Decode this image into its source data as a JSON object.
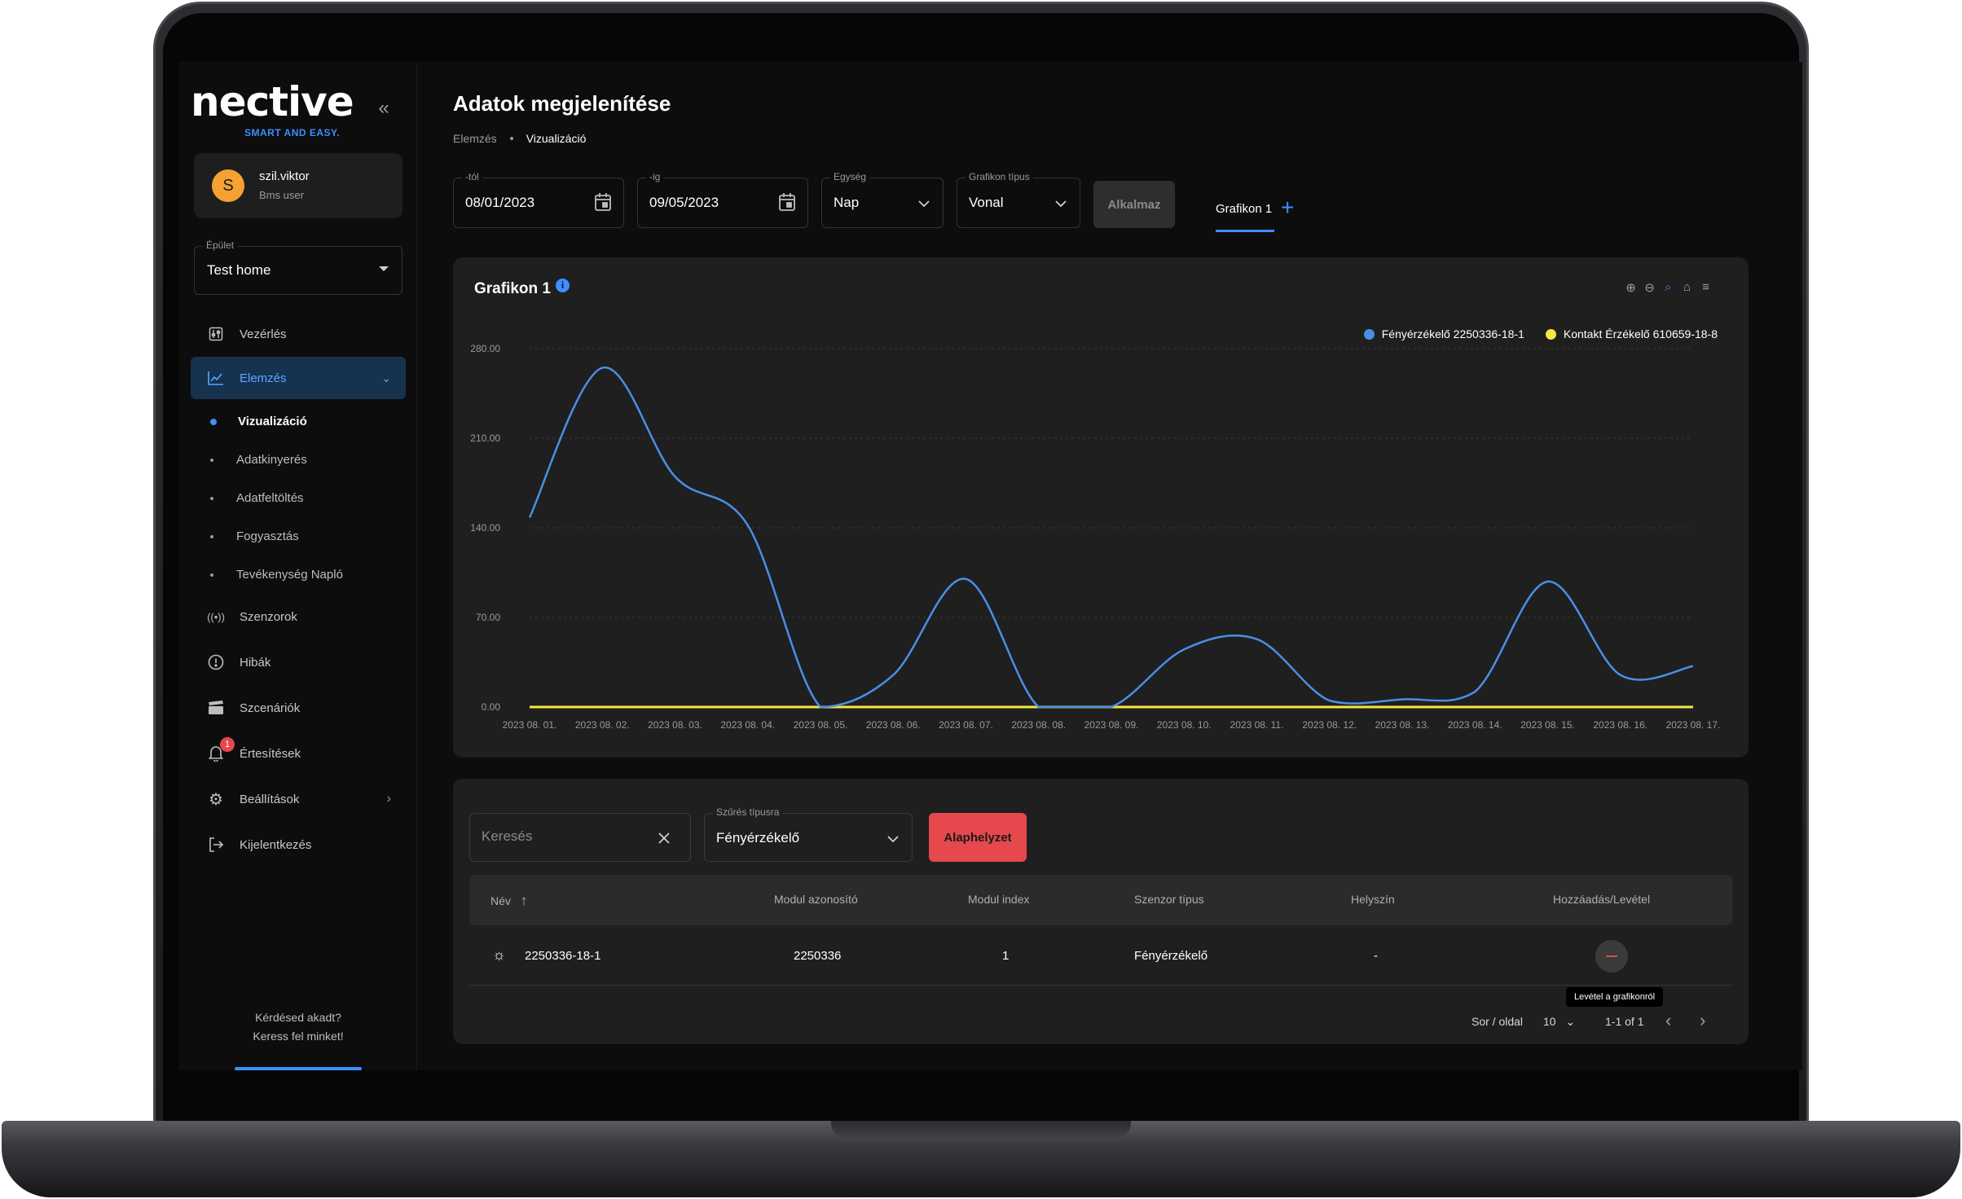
{
  "app": {
    "logo": "nective",
    "tagline": "SMART AND EASY.",
    "collapse_icon": "double-chevron-left-icon"
  },
  "user": {
    "initial": "S",
    "name": "szil.viktor",
    "role": "Bms user",
    "avatar_color": "#f5a133"
  },
  "building": {
    "label": "Épület",
    "value": "Test home"
  },
  "nav": {
    "items": [
      {
        "label": "Vezérlés",
        "icon": "control-panel-icon"
      },
      {
        "label": "Elemzés",
        "icon": "chart-line-icon",
        "active": true
      },
      {
        "label": "Szenzorok",
        "icon": "sensor-icon"
      },
      {
        "label": "Hibák",
        "icon": "alert-circle-icon"
      },
      {
        "label": "Szcenáriók",
        "icon": "clapper-icon"
      },
      {
        "label": "Értesítések",
        "icon": "bell-icon",
        "badge": "1"
      },
      {
        "label": "Beállítások",
        "icon": "gear-icon"
      },
      {
        "label": "Kijelentkezés",
        "icon": "logout-icon"
      }
    ],
    "subitems": [
      {
        "label": "Vizualizáció",
        "active": true
      },
      {
        "label": "Adatkinyerés"
      },
      {
        "label": "Adatfeltöltés"
      },
      {
        "label": "Fogyasztás"
      },
      {
        "label": "Tevékenység Napló"
      }
    ]
  },
  "help": {
    "line1": "Kérdésed akadt?",
    "line2": "Keress fel minket!"
  },
  "page": {
    "title": "Adatok megjelenítése",
    "breadcrumb": [
      "Elemzés",
      "Vizualizáció"
    ]
  },
  "filters": {
    "from_label": "-tól",
    "from_value": "08/01/2023",
    "to_label": "-ig",
    "to_value": "09/05/2023",
    "unit_label": "Egység",
    "unit_value": "Nap",
    "type_label": "Grafikon típus",
    "type_value": "Vonal",
    "apply_label": "Alkalmaz"
  },
  "tabs": {
    "active": "Grafikon 1",
    "add_icon": "plus-icon"
  },
  "chart_card": {
    "title": "Grafikon 1",
    "toolbar_icons": [
      "zoom-in-icon",
      "zoom-out-icon",
      "zoom-select-icon",
      "home-icon",
      "menu-icon"
    ]
  },
  "chart_data": {
    "type": "line",
    "title": "Grafikon 1",
    "categories": [
      "2023 08. 01.",
      "2023 08. 02.",
      "2023 08. 03.",
      "2023 08. 04.",
      "2023 08. 05.",
      "2023 08. 06.",
      "2023 08. 07.",
      "2023 08. 08.",
      "2023 08. 09.",
      "2023 08. 10.",
      "2023 08. 11.",
      "2023 08. 12.",
      "2023 08. 13.",
      "2023 08. 14.",
      "2023 08. 15.",
      "2023 08. 16.",
      "2023 08. 17."
    ],
    "series": [
      {
        "name": "Fényérzékelő 2250336-18-1",
        "color": "#4a8fe7",
        "values": [
          148,
          265,
          180,
          142,
          0,
          25,
          100,
          0,
          0,
          45,
          53,
          5,
          6,
          12,
          98,
          25,
          32
        ]
      },
      {
        "name": "Kontakt Érzékelő 610659-18-8",
        "color": "#f5e642",
        "values": [
          0,
          0,
          0,
          0,
          0,
          0,
          0,
          0,
          0,
          0,
          0,
          0,
          0,
          0,
          0,
          0,
          0
        ]
      }
    ],
    "y_ticks": [
      "0.00",
      "70.00",
      "140.00",
      "210.00",
      "280.00"
    ],
    "ylim": [
      0,
      280
    ],
    "grid": true,
    "legend": "top-right"
  },
  "table": {
    "search_placeholder": "Keresés",
    "filter_label": "Szűrés típusra",
    "filter_value": "Fényérzékelő",
    "reset_label": "Alaphelyzet",
    "headers": [
      "Név",
      "Modul azonosító",
      "Modul index",
      "Szenzor típus",
      "Helyszín",
      "Hozzáadás/Levétel"
    ],
    "rows": [
      {
        "name": "2250336-18-1",
        "module_id": "2250336",
        "module_index": "1",
        "sensor_type": "Fényérzékelő",
        "location": "-",
        "icon": "sun-icon"
      }
    ],
    "tooltip": "Levétel a grafikonról",
    "rows_per_page_label": "Sor / oldal",
    "rows_per_page": "10",
    "range": "1-1 of 1"
  }
}
